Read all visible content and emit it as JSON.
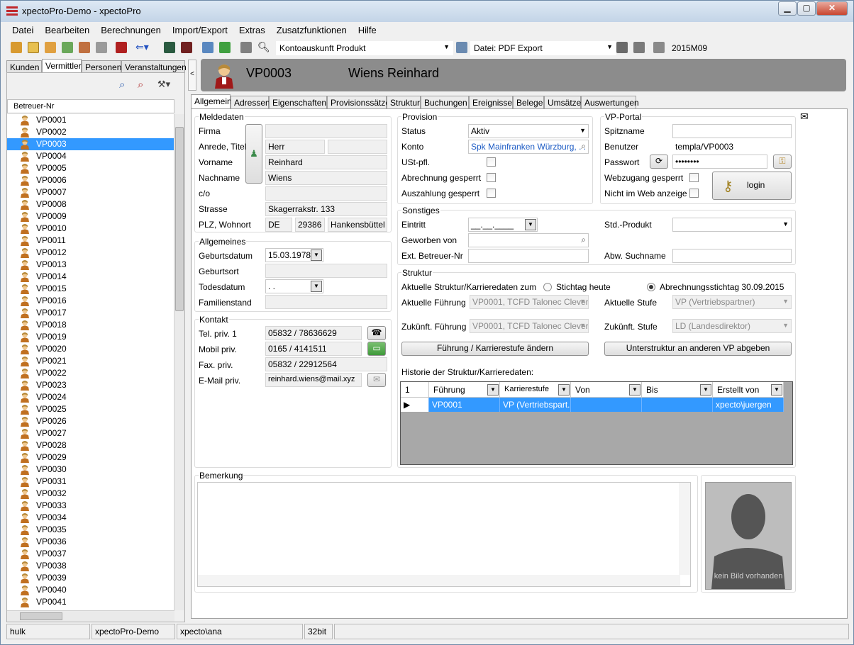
{
  "window": {
    "title": "xpectoPro-Demo - xpectoPro",
    "controls": {
      "minimize": "▁",
      "maximize": "▢",
      "close": "✕"
    }
  },
  "menu": [
    "Datei",
    "Bearbeiten",
    "Berechnungen",
    "Import/Export",
    "Extras",
    "Zusatzfunktionen",
    "Hilfe"
  ],
  "toolbar": {
    "report_combo": "Kontoauskunft Produkt",
    "export_combo": "Datei: PDF Export",
    "period": "2015M09"
  },
  "left_tabs": [
    "Kunden",
    "Vermittler",
    "Personen",
    "Veranstaltungen"
  ],
  "left_active_tab": 1,
  "list": {
    "column_header": "Betreuer-Nr",
    "items": [
      "VP0001",
      "VP0002",
      "VP0003",
      "VP0004",
      "VP0005",
      "VP0006",
      "VP0007",
      "VP0008",
      "VP0009",
      "VP0010",
      "VP0011",
      "VP0012",
      "VP0013",
      "VP0014",
      "VP0015",
      "VP0016",
      "VP0017",
      "VP0018",
      "VP0019",
      "VP0020",
      "VP0021",
      "VP0022",
      "VP0023",
      "VP0024",
      "VP0025",
      "VP0026",
      "VP0027",
      "VP0028",
      "VP0029",
      "VP0030",
      "VP0031",
      "VP0032",
      "VP0033",
      "VP0034",
      "VP0035",
      "VP0036",
      "VP0037",
      "VP0038",
      "VP0039",
      "VP0040",
      "VP0041"
    ],
    "selected_index": 2
  },
  "header": {
    "code": "VP0003",
    "name": "Wiens Reinhard",
    "collapse_glyph": "<"
  },
  "tabs": [
    "Allgemein",
    "Adressen",
    "Eigenschaften",
    "Provisionssätze",
    "Struktur",
    "Buchungen",
    "Ereignisse",
    "Belege",
    "Umsätze",
    "Auswertungen"
  ],
  "active_tab": 0,
  "meldedaten": {
    "title": "Meldedaten",
    "firma_label": "Firma",
    "firma": "",
    "anrede_label": "Anrede, Titel",
    "anrede": "Herr",
    "titel": "",
    "vorname_label": "Vorname",
    "vorname": "Reinhard",
    "nachname_label": "Nachname",
    "nachname": "Wiens",
    "co_label": "c/o",
    "co": "",
    "strasse_label": "Strasse",
    "strasse": "Skagerrakstr. 133",
    "plz_label": "PLZ, Wohnort",
    "land": "DE",
    "plz": "29386",
    "ort": "Hankensbüttel"
  },
  "allgemeines": {
    "title": "Allgemeines",
    "geburtsdatum_label": "Geburtsdatum",
    "geburtsdatum": "15.03.1978",
    "geburtsort_label": "Geburtsort",
    "geburtsort": "",
    "todesdatum_label": "Todesdatum",
    "todesdatum": " .  .",
    "familienstand_label": "Familienstand",
    "familienstand": ""
  },
  "kontakt": {
    "title": "Kontakt",
    "tel_label": "Tel. priv. 1",
    "tel": "05832 / 78636629",
    "mobil_label": "Mobil priv.",
    "mobil": "0165 / 4141511",
    "fax_label": "Fax. priv.",
    "fax": "05832 / 22912564",
    "email_label": "E-Mail priv.",
    "email": "reinhard.wiens@mail.xyz"
  },
  "provision": {
    "title": "Provision",
    "status_label": "Status",
    "status": "Aktiv",
    "konto_label": "Konto",
    "konto": "Spk Mainfranken Würzburg, . .",
    "ust_label": "USt-pfl.",
    "ust": false,
    "abrechnung_label": "Abrechnung gesperrt",
    "abrechnung_gesperrt": false,
    "auszahlung_label": "Auszahlung gesperrt",
    "auszahlung_gesperrt": false
  },
  "portal": {
    "title": "VP-Portal",
    "spitzname_label": "Spitzname",
    "spitzname": "",
    "benutzer_label": "Benutzer",
    "benutzer": "templa/VP0003",
    "passwort_label": "Passwort",
    "passwort": "••••••••",
    "webzugang_label": "Webzugang gesperrt",
    "webzugang_gesperrt": false,
    "nichtimweb_label": "Nicht im Web anzeige",
    "nicht_im_web": false,
    "login_label": "login"
  },
  "sonstiges": {
    "title": "Sonstiges",
    "eintritt_label": "Eintritt",
    "eintritt": "__.__.____",
    "geworben_label": "Geworben von",
    "geworben": "",
    "ext_label": "Ext. Betreuer-Nr",
    "ext": "",
    "std_label": "Std.-Produkt",
    "std": "",
    "abw_label": "Abw. Suchname",
    "abw": ""
  },
  "struktur": {
    "title": "Struktur",
    "aktuelle_daten_label": "Aktuelle Struktur/Karrieredaten zum",
    "radio_heute": "Stichtag heute",
    "radio_abrechnung": "Abrechnungsstichtag 30.09.2015",
    "selected_radio": "abrechnung",
    "akt_fuehrung_label": "Aktuelle Führung",
    "akt_fuehrung": "VP0001, TCFD Talonec Clever",
    "akt_stufe_label": "Aktuelle Stufe",
    "akt_stufe": "VP (Vertriebspartner)",
    "zuk_fuehrung_label": "Zukünft. Führung",
    "zuk_fuehrung": "VP0001, TCFD Talonec Clever",
    "zuk_stufe_label": "Zukünft. Stufe",
    "zuk_stufe": "LD (Landesdirektor)",
    "btn_aendern": "Führung / Karrierestufe ändern",
    "btn_abgeben": "Unterstruktur an anderen VP abgeben",
    "historie_label": "Historie der Struktur/Karrieredaten:",
    "historie_columns": [
      "1",
      "Führung",
      "Karrierestufe",
      "Von",
      "Bis",
      "Erstellt von"
    ],
    "historie_rows": [
      [
        "VP0001",
        "VP (Vertriebspart...",
        "",
        "",
        "xpecto\\juergen"
      ]
    ]
  },
  "bemerkung": {
    "title": "Bemerkung",
    "text": ""
  },
  "photo": {
    "caption": "kein Bild vorhanden"
  },
  "status": [
    "hulk",
    "xpectoPro-Demo",
    "xpecto\\ana",
    "32bit"
  ],
  "colors": {
    "selection": "#3399ff",
    "header_bg": "#8c8c8c",
    "link": "#1c5bc4"
  }
}
